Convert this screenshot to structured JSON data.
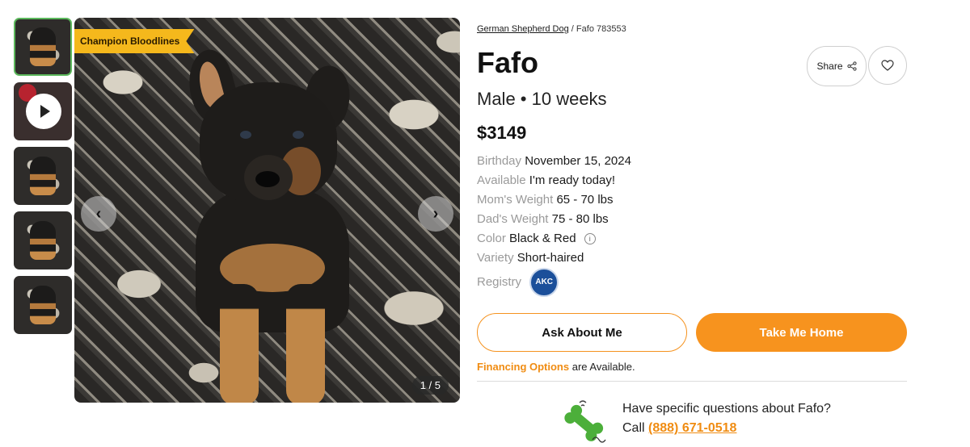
{
  "gallery": {
    "thumbnails": [
      {
        "kind": "photo",
        "active": true
      },
      {
        "kind": "video",
        "active": false
      },
      {
        "kind": "photo",
        "active": false
      },
      {
        "kind": "photo",
        "active": false
      },
      {
        "kind": "photo",
        "active": false
      }
    ],
    "badge": "Champion Bloodlines",
    "prev_icon": "‹",
    "next_icon": "›",
    "counter": "1 / 5"
  },
  "breadcrumb": {
    "breed": "German Shepherd Dog",
    "separator": "/",
    "current": "Fafo 783553"
  },
  "puppy": {
    "name": "Fafo",
    "subtitle": "Male • 10 weeks",
    "price": "$3149"
  },
  "actions": {
    "share_label": "Share",
    "share_icon": "share-icon",
    "favorite_icon": "heart-icon"
  },
  "specs": {
    "birthday": {
      "label": "Birthday",
      "value": "November 15, 2024"
    },
    "available": {
      "label": "Available",
      "value": "I'm ready today!"
    },
    "moms_weight": {
      "label": "Mom's Weight",
      "value": "65 - 70 lbs"
    },
    "dads_weight": {
      "label": "Dad's Weight",
      "value": "75 - 80 lbs"
    },
    "color": {
      "label": "Color",
      "value": "Black & Red",
      "info": "i"
    },
    "variety": {
      "label": "Variety",
      "value": "Short-haired"
    },
    "registry": {
      "label": "Registry",
      "logo_text": "AKC"
    }
  },
  "cta": {
    "ask_label": "Ask About Me",
    "home_label": "Take Me Home"
  },
  "financing": {
    "link": "Financing Options",
    "suffix": "are Available."
  },
  "contact": {
    "question": "Have specific questions about Fafo?",
    "call_prefix": "Call",
    "phone": "(888) 671-0518"
  },
  "colors": {
    "accent_orange": "#f7931e",
    "badge_yellow": "#f5b81c",
    "thumb_active_border": "#5cb85c",
    "akc_blue": "#1b4f9a",
    "bone_green": "#4caf3a"
  }
}
